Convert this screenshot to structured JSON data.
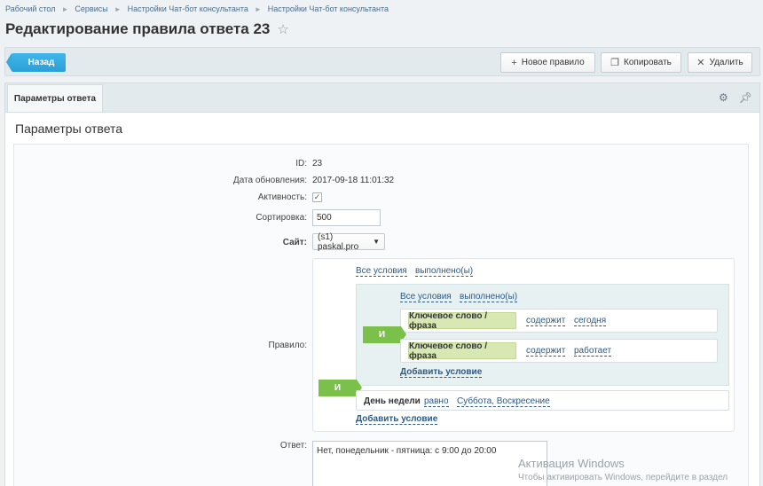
{
  "breadcrumb": [
    "Рабочий стол",
    "Сервисы",
    "Настройки Чат-бот консультанта",
    "Настройки Чат-бот консультанта"
  ],
  "page_title": "Редактирование правила ответа 23",
  "toolbar": {
    "back_label": "Назад",
    "new_rule_label": "Новое правило",
    "copy_label": "Копировать",
    "delete_label": "Удалить"
  },
  "tab": {
    "label": "Параметры ответа"
  },
  "section_title": "Параметры ответа",
  "form": {
    "id_label": "ID:",
    "id_value": "23",
    "updated_label": "Дата обновления:",
    "updated_value": "2017-09-18 11:01:32",
    "active_label": "Активность:",
    "active_checked": true,
    "sort_label": "Сортировка:",
    "sort_value": "500",
    "site_label": "Сайт:",
    "site_value": "(s1) paskal.pro",
    "rule_label": "Правило:",
    "answer_label": "Ответ:",
    "answer_value": "Нет, понедельник - пятница: с 9:00 до 20:00"
  },
  "rule": {
    "outer_all": "Все условия",
    "outer_done": "выполнено(ы)",
    "outer_and": "И",
    "inner_all": "Все условия",
    "inner_done": "выполнено(ы)",
    "inner_and": "И",
    "conditions": [
      {
        "field": "Ключевое слово / фраза",
        "op": "содержит",
        "value": "сегодня"
      },
      {
        "field": "Ключевое слово / фраза",
        "op": "содержит",
        "value": "работает"
      }
    ],
    "inner_add": "Добавить условие",
    "day_condition": {
      "field": "День недели",
      "op": "равно",
      "value": "Суббота, Воскресение"
    },
    "outer_add": "Добавить условие"
  },
  "watermark": {
    "title": "Активация Windows",
    "text": "Чтобы активировать Windows, перейдите в раздел"
  },
  "colors": {
    "accent": "#2b9fd8",
    "and_badge": "#7bc04b",
    "chip": "#d7e8b2",
    "link": "#2d5a86"
  }
}
